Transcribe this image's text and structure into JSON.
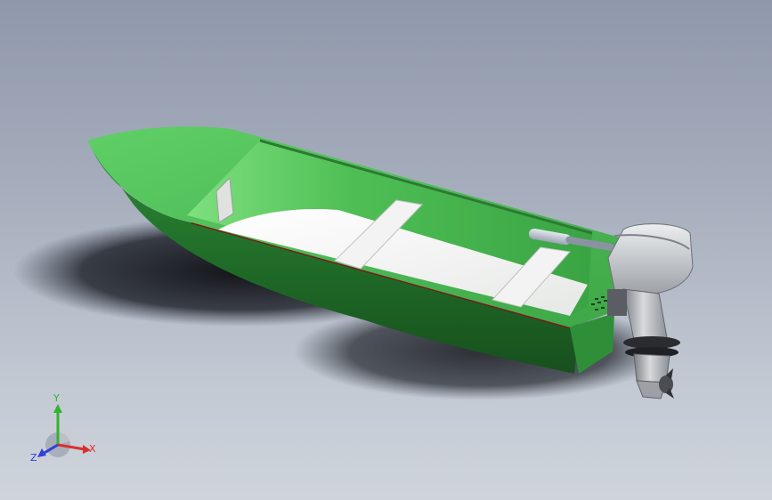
{
  "viewport": {
    "colors": {
      "hull_green": "#3fa84a",
      "hull_dark": "#1f5c25",
      "deck_white": "#f4f5f4",
      "stripe_red": "#7a1a1a",
      "motor_grey": "#b9bcc0"
    }
  },
  "triad": {
    "x_label": "X",
    "y_label": "Y",
    "z_label": "Z",
    "x_color": "#d83030",
    "y_color": "#2fb52f",
    "z_color": "#3040d8"
  }
}
